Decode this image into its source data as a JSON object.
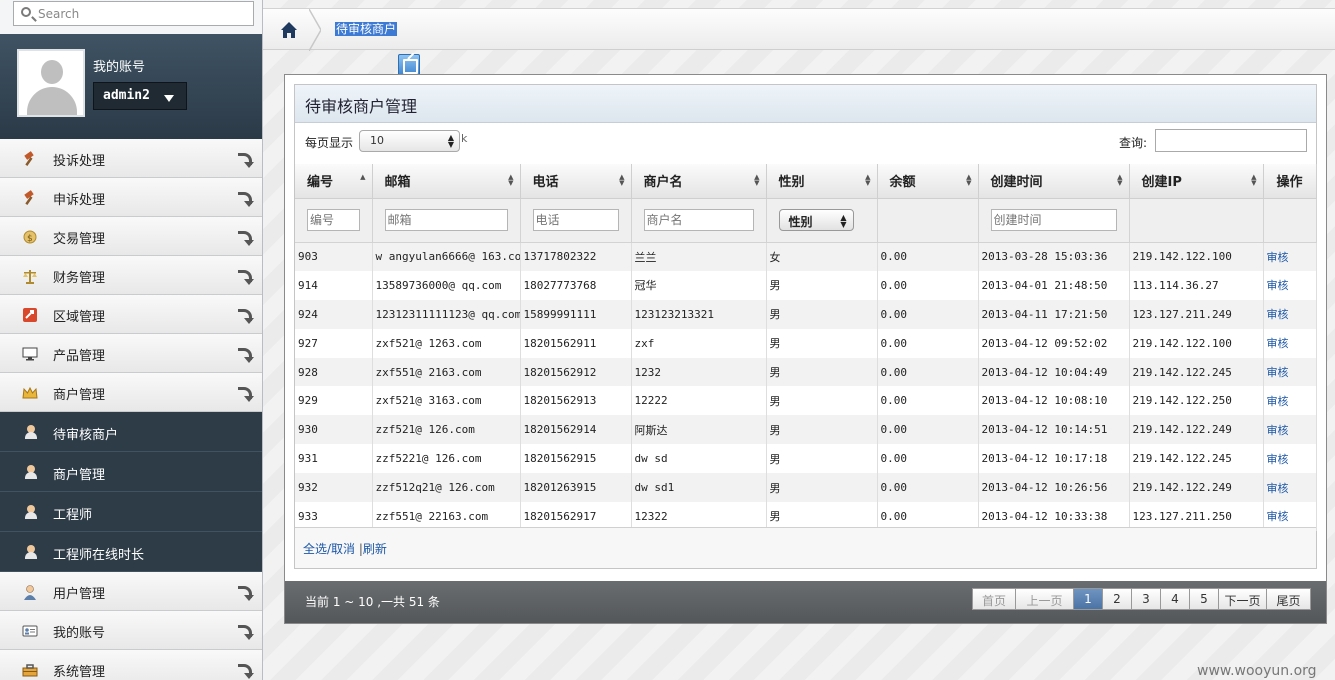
{
  "search": {
    "placeholder": "Search"
  },
  "account": {
    "title": "我的账号",
    "username": "admin2"
  },
  "sidebar": {
    "top_items": [
      {
        "label": "投诉处理",
        "icon": "hammer-icon"
      },
      {
        "label": "申诉处理",
        "icon": "hammer-icon"
      },
      {
        "label": "交易管理",
        "icon": "coins-icon"
      },
      {
        "label": "财务管理",
        "icon": "scale-icon"
      },
      {
        "label": "区域管理",
        "icon": "region-icon"
      },
      {
        "label": "产品管理",
        "icon": "monitor-icon"
      },
      {
        "label": "商户管理",
        "icon": "crown-icon"
      }
    ],
    "sub_items": [
      {
        "label": "待审核商户",
        "icon": "user-icon"
      },
      {
        "label": "商户管理",
        "icon": "user-icon"
      },
      {
        "label": "工程师",
        "icon": "user-icon"
      },
      {
        "label": "工程师在线时长",
        "icon": "user-icon"
      }
    ],
    "bottom_items": [
      {
        "label": "用户管理",
        "icon": "user-icon"
      },
      {
        "label": "我的账号",
        "icon": "id-card-icon"
      },
      {
        "label": "系统管理",
        "icon": "toolbox-icon"
      }
    ]
  },
  "breadcrumb": {
    "current": "待审核商户"
  },
  "panel": {
    "title": "待审核商户管理",
    "per_page_label": "每页显示",
    "per_page_value": "10",
    "per_page_suffix": "k",
    "query_label": "查询:",
    "columns": [
      "编号",
      "邮箱",
      "电话",
      "商户名",
      "性别",
      "余额",
      "创建时间",
      "创建IP",
      "操作"
    ],
    "filter_placeholders": {
      "id": "编号",
      "email": "邮箱",
      "phone": "电话",
      "name": "商户名",
      "gender": "性别",
      "created": "创建时间"
    },
    "rows": [
      [
        "903",
        "w angyulan6666@ 163.com",
        "13717802322",
        "兰兰",
        "女",
        "0.00",
        "2013-03-28 15:03:36",
        "219.142.122.100",
        "审核"
      ],
      [
        "914",
        "13589736000@ qq.com",
        "18027773768",
        "冠华",
        "男",
        "0.00",
        "2013-04-01 21:48:50",
        "113.114.36.27",
        "审核"
      ],
      [
        "924",
        "12312311111123@ qq.com",
        "15899991111",
        "123123213321",
        "男",
        "0.00",
        "2013-04-11 17:21:50",
        "123.127.211.249",
        "审核"
      ],
      [
        "927",
        "zxf521@ 1263.com",
        "18201562911",
        "zxf",
        "男",
        "0.00",
        "2013-04-12 09:52:02",
        "219.142.122.100",
        "审核"
      ],
      [
        "928",
        "zxf551@ 2163.com",
        "18201562912",
        "1232",
        "男",
        "0.00",
        "2013-04-12 10:04:49",
        "219.142.122.245",
        "审核"
      ],
      [
        "929",
        "zxf521@ 3163.com",
        "18201562913",
        "12222",
        "男",
        "0.00",
        "2013-04-12 10:08:10",
        "219.142.122.250",
        "审核"
      ],
      [
        "930",
        "zzf521@ 126.com",
        "18201562914",
        "阿斯达",
        "男",
        "0.00",
        "2013-04-12 10:14:51",
        "219.142.122.249",
        "审核"
      ],
      [
        "931",
        "zzf5221@ 126.com",
        "18201562915",
        "dw sd",
        "男",
        "0.00",
        "2013-04-12 10:17:18",
        "219.142.122.245",
        "审核"
      ],
      [
        "932",
        "zzf512q21@ 126.com",
        "18201263915",
        "dw sd1",
        "男",
        "0.00",
        "2013-04-12 10:26:56",
        "219.142.122.249",
        "审核"
      ],
      [
        "933",
        "zzf551@ 22163.com",
        "18201562917",
        "12322",
        "男",
        "0.00",
        "2013-04-12 10:33:38",
        "123.127.211.250",
        "审核"
      ]
    ],
    "footer": {
      "select_all": "全选/取消",
      "refresh": "刷新"
    }
  },
  "pager": {
    "info": "当前 1 ~ 10 ,一共 51 条",
    "buttons": [
      "首页",
      "上一页",
      "1",
      "2",
      "3",
      "4",
      "5",
      "下一页",
      "尾页"
    ]
  },
  "watermark": "www.wooyun.org",
  "colors": {
    "sidebar_dark": "#2e3c48",
    "link": "#1d57a8",
    "pager_active": "#4b73a5"
  }
}
